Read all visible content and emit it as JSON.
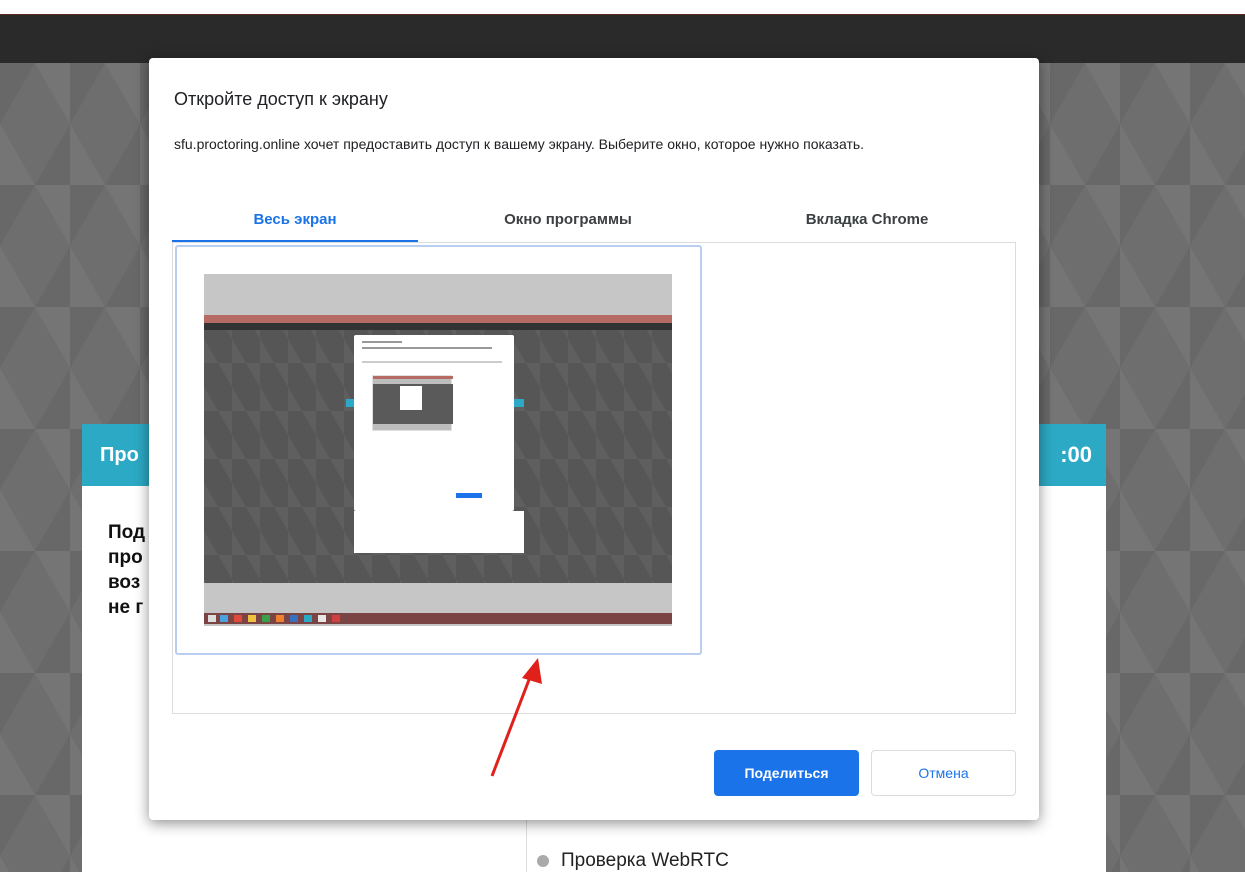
{
  "dialog": {
    "title": "Откройте доступ к экрану",
    "description": "sfu.proctoring.online хочет предоставить доступ к вашему экрану. Выберите окно, которое нужно показать.",
    "tabs": [
      {
        "label": "Весь экран",
        "active": true
      },
      {
        "label": "Окно программы",
        "active": false
      },
      {
        "label": "Вкладка Chrome",
        "active": false
      }
    ],
    "share_label": "Поделиться",
    "cancel_label": "Отмена"
  },
  "background": {
    "header_title": "Про",
    "timer": ":00",
    "body_lines": [
      "Под",
      "про",
      "воз",
      "не г"
    ],
    "check_item": "Проверка WebRTC"
  },
  "colors": {
    "accent": "#1a73e8",
    "header_teal": "#2ca9c4",
    "annotation_arrow": "#e0201a"
  },
  "icons": [
    "screen-thumbnail",
    "annotation-arrow"
  ]
}
